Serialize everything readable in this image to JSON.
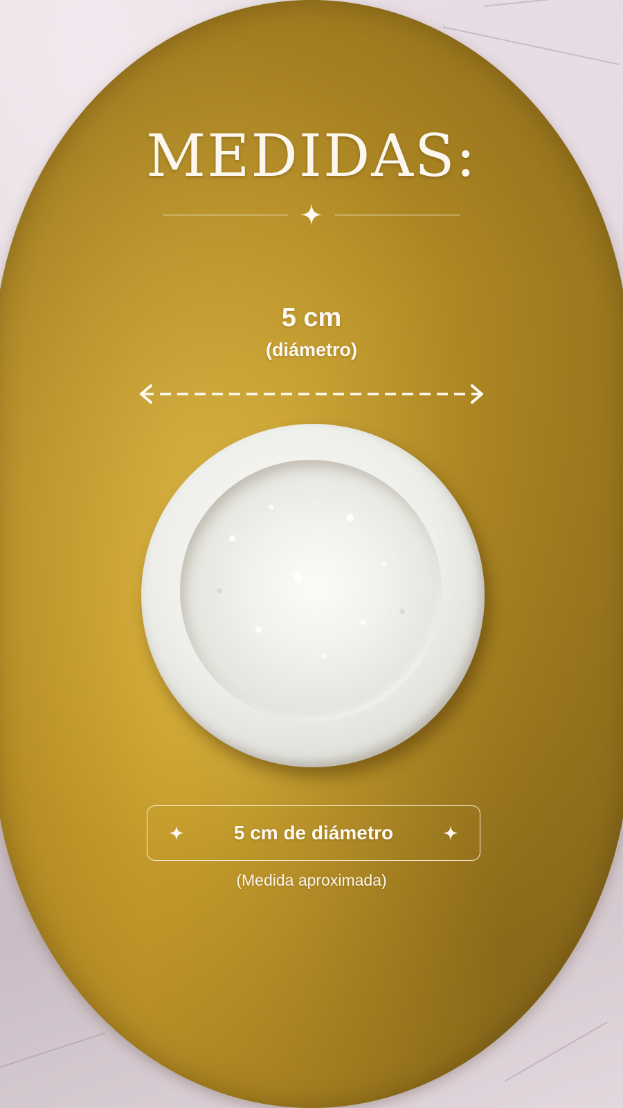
{
  "heading": {
    "title": "MEDIDAS:"
  },
  "divider": {
    "icon": "sparkle-icon"
  },
  "measurement": {
    "value": "5 cm",
    "label": "(diámetro)",
    "arrow_icon": "double-arrow-dashed-icon"
  },
  "badge": {
    "text": "5 cm de diámetro",
    "left_icon": "sparkle-icon",
    "right_icon": "sparkle-icon"
  },
  "note": {
    "text": "(Medida aproximada)"
  },
  "colors": {
    "gold": "#b48c24",
    "text": "#fdfaf3",
    "marble": "#e3d8de"
  }
}
